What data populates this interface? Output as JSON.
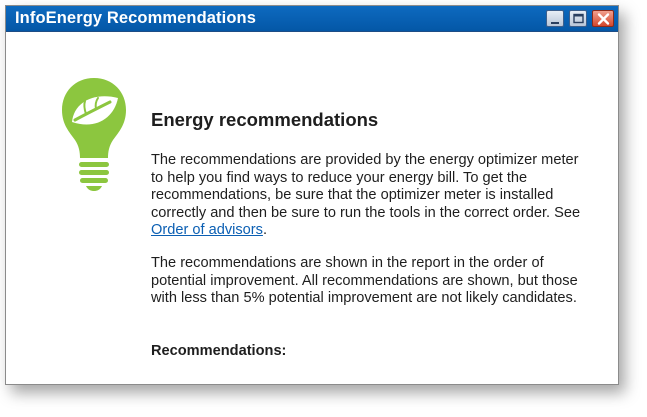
{
  "window": {
    "title": "InfoEnergy Recommendations"
  },
  "content": {
    "heading": "Energy recommendations",
    "paragraph1_text": "The recommendations are provided by the energy optimizer meter to help you find ways to reduce your energy bill. To get the recommendations, be sure that the optimizer meter is installed correctly and then be sure to run the tools in the correct order. See ",
    "paragraph1_link": "Order of advisors",
    "paragraph1_end": ".",
    "paragraph2": "The recommendations are shown in the report in the order of potential improvement. All recommendations are shown, but those with less than 5% potential improvement are not likely candidates.",
    "subheading": "Recommendations:"
  },
  "icons": {
    "bulb": "lightbulb-leaf-icon",
    "minimize": "minimize-icon",
    "maximize": "maximize-icon",
    "close": "close-icon"
  },
  "colors": {
    "titlebar": "#0457a6",
    "bulb_green": "#8cc63f",
    "link": "#0b5fb3",
    "close_button": "#d3472d"
  }
}
